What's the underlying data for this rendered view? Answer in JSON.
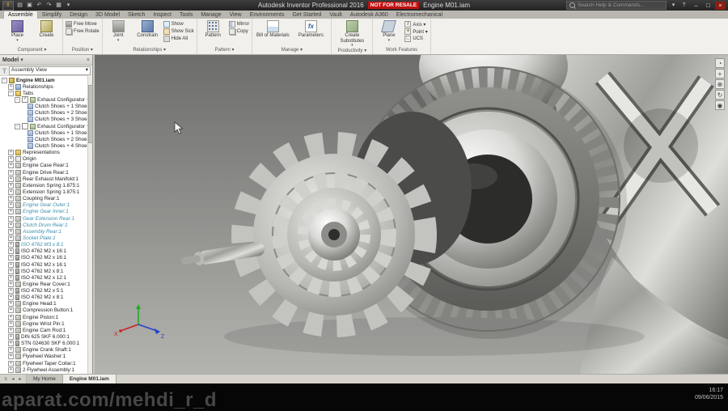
{
  "titlebar": {
    "app_button": "I",
    "app_title": "Autodesk Inventor Professional 2016",
    "license_badge": "NOT FOR RESALE",
    "doc_title": "Engine M01.iam",
    "search_placeholder": "Search Help & Commands...",
    "qat_icons": [
      {
        "name": "open-icon",
        "glyph": "▤"
      },
      {
        "name": "save-icon",
        "glyph": "▣"
      },
      {
        "name": "undo-icon",
        "glyph": "↶"
      },
      {
        "name": "redo-icon",
        "glyph": "↷"
      },
      {
        "name": "print-icon",
        "glyph": "▦"
      },
      {
        "name": "dropdown-icon",
        "glyph": "▾"
      }
    ],
    "right_icons": [
      {
        "name": "sign-in-icon",
        "glyph": "▾"
      },
      {
        "name": "help-icon",
        "glyph": "?"
      }
    ],
    "window": {
      "minimize": "–",
      "maximize": "□",
      "close": "×"
    }
  },
  "ribbon": {
    "tabs": [
      {
        "label": "Assemble",
        "active": true
      },
      {
        "label": "Simplify",
        "active": false
      },
      {
        "label": "Design",
        "active": false
      },
      {
        "label": "3D Model",
        "active": false
      },
      {
        "label": "Sketch",
        "active": false
      },
      {
        "label": "Inspect",
        "active": false
      },
      {
        "label": "Tools",
        "active": false
      },
      {
        "label": "Manage",
        "active": false
      },
      {
        "label": "View",
        "active": false
      },
      {
        "label": "Environments",
        "active": false
      },
      {
        "label": "Get Started",
        "active": false
      },
      {
        "label": "Vault",
        "active": false
      },
      {
        "label": "Autodesk A360",
        "active": false
      },
      {
        "label": "Electromechanical",
        "active": false
      }
    ],
    "panels": [
      {
        "label": "Component",
        "arrow": true,
        "tools": [
          {
            "t": "Place",
            "size": "big",
            "icon": "place",
            "drop": true
          },
          {
            "t": "Create",
            "size": "big",
            "icon": "create"
          }
        ]
      },
      {
        "label": "Position",
        "arrow": true,
        "tools": [
          {
            "t": "Free Move",
            "size": "small",
            "icon": "joint"
          },
          {
            "t": "Free Rotate",
            "size": "small",
            "icon": "copy"
          }
        ]
      },
      {
        "label": "Relationships",
        "arrow": true,
        "tools": [
          {
            "t": "Joint",
            "size": "big",
            "icon": "joint",
            "drop": true
          },
          {
            "t": "Constrain",
            "size": "big",
            "icon": "constrain"
          },
          {
            "t": "Show",
            "size": "small",
            "icon": "show"
          },
          {
            "t": "Show Sick",
            "size": "small",
            "icon": "sick"
          },
          {
            "t": "Hide All",
            "size": "small",
            "icon": "hide"
          }
        ]
      },
      {
        "label": "Pattern",
        "arrow": true,
        "tools": [
          {
            "t": "Pattern",
            "size": "big",
            "icon": "pattern"
          },
          {
            "t": "Mirror",
            "size": "small",
            "icon": "mirror"
          },
          {
            "t": "Copy",
            "size": "small",
            "icon": "copy"
          }
        ]
      },
      {
        "label": "Manage",
        "arrow": true,
        "tools": [
          {
            "t": "Bill of Materials",
            "size": "big2",
            "icon": "bom"
          },
          {
            "t": "Parameters",
            "size": "big2",
            "icon": "fx",
            "glyph": "fx"
          }
        ]
      },
      {
        "label": "Productivity",
        "arrow": true,
        "tools": [
          {
            "t": "Create Substitutes",
            "size": "big2",
            "icon": "subst",
            "drop": true
          }
        ]
      },
      {
        "label": "Work Features",
        "arrow": false,
        "tools": [
          {
            "t": "Plane",
            "size": "big",
            "icon": "plane",
            "drop": true
          },
          {
            "t": "Axis",
            "size": "small",
            "icon": "axis",
            "glyph": "/",
            "drop": true
          },
          {
            "t": "Point",
            "size": "small",
            "icon": "point",
            "glyph": "+",
            "drop": true
          },
          {
            "t": "UCS",
            "size": "small",
            "icon": "ucs",
            "glyph": "∟"
          }
        ]
      }
    ]
  },
  "browser": {
    "header_title": "Model",
    "header_arrow": "▾",
    "header_close": "×",
    "view_selector": "Assembly View",
    "selector_arrow": "▾",
    "tree": [
      {
        "label": "Engine M01.iam",
        "icon": "assembly",
        "level": 0,
        "bold": true,
        "exp": "-"
      },
      {
        "label": "Relationships",
        "icon": "rel",
        "level": 1,
        "exp": "+"
      },
      {
        "label": "Tabs",
        "icon": "folder",
        "level": 1,
        "exp": "-"
      },
      {
        "label": "Exhaust Configurator + Rear",
        "icon": "cfg",
        "level": 2,
        "exp": "-",
        "check": true
      },
      {
        "label": "Clutch Shoes + 1 Shoe",
        "icon": "clutch",
        "level": 3
      },
      {
        "label": "Clutch Shoes + 2 Shoe",
        "icon": "clutch",
        "level": 3
      },
      {
        "label": "Clutch Shoes + 3 Shoe",
        "icon": "clutch",
        "level": 3
      },
      {
        "label": "Exhaust Configurator + Side",
        "icon": "cfg",
        "level": 2,
        "exp": "-",
        "check": false
      },
      {
        "label": "Clutch Shoes + 1 Shoe",
        "icon": "clutch",
        "level": 3
      },
      {
        "label": "Clutch Shoes + 2 Shoe",
        "icon": "clutch",
        "level": 3
      },
      {
        "label": "Clutch Shoes + 4 Shoe",
        "icon": "clutch",
        "level": 3
      },
      {
        "label": "Representations",
        "icon": "folder",
        "level": 1,
        "exp": "+"
      },
      {
        "label": "Origin",
        "icon": "origin",
        "level": 1,
        "exp": "+"
      },
      {
        "label": "Engine Case Rear:1",
        "icon": "part",
        "level": 1,
        "exp": "+"
      },
      {
        "label": "Engine Drive Rear:1",
        "icon": "part",
        "level": 1,
        "exp": "+"
      },
      {
        "label": "Rear Exhaust Manifold:1",
        "icon": "part",
        "level": 1,
        "exp": "+"
      },
      {
        "label": "Extension Spring 1.875:1",
        "icon": "part",
        "level": 1,
        "exp": "+"
      },
      {
        "label": "Extension Spring 1.875:1",
        "icon": "part",
        "level": 1,
        "exp": "+"
      },
      {
        "label": "Coupling Rear:1",
        "icon": "part",
        "level": 1,
        "exp": "+"
      },
      {
        "label": "Engine Gear Outer:1",
        "icon": "part",
        "level": 1,
        "exp": "+",
        "hl": true
      },
      {
        "label": "Engine Gear Inner:1",
        "icon": "part",
        "level": 1,
        "exp": "+",
        "hl": true
      },
      {
        "label": "Gear Extension Rear:1",
        "icon": "part",
        "level": 1,
        "exp": "+",
        "hl": true
      },
      {
        "label": "Clutch Drum Rear:1",
        "icon": "part",
        "level": 1,
        "exp": "+",
        "hl": true
      },
      {
        "label": "Assembly Rear:1",
        "icon": "part",
        "level": 1,
        "exp": "+",
        "hl": true
      },
      {
        "label": "Socket Plate:1",
        "icon": "part",
        "level": 1,
        "exp": "+",
        "hl": true
      },
      {
        "label": "ISO 4762 M3 x 8:1",
        "icon": "bolt",
        "level": 1,
        "exp": "+",
        "hl": true
      },
      {
        "label": "ISO 4762 M2 x 16:1",
        "icon": "bolt",
        "level": 1,
        "exp": "+"
      },
      {
        "label": "ISO 4762 M2 x 16:1",
        "icon": "bolt",
        "level": 1,
        "exp": "+"
      },
      {
        "label": "ISO 4762 M2 x 16:1",
        "icon": "bolt",
        "level": 1,
        "exp": "+"
      },
      {
        "label": "ISO 4762 M2 x 8:1",
        "icon": "bolt",
        "level": 1,
        "exp": "+"
      },
      {
        "label": "ISO 4762 M2 x 12:1",
        "icon": "bolt",
        "level": 1,
        "exp": "+"
      },
      {
        "label": "Engine Rear Cover:1",
        "icon": "part",
        "level": 1,
        "exp": "+"
      },
      {
        "label": "ISO 4762 M2 x 5:1",
        "icon": "bolt",
        "level": 1,
        "exp": "+"
      },
      {
        "label": "ISO 4762 M2 x 8:1",
        "icon": "bolt",
        "level": 1,
        "exp": "+"
      },
      {
        "label": "Engine Head:1",
        "icon": "part",
        "level": 1,
        "exp": "+"
      },
      {
        "label": "Compression Button:1",
        "icon": "part",
        "level": 1,
        "exp": "+"
      },
      {
        "label": "Engine Piston:1",
        "icon": "part",
        "level": 1,
        "exp": "+"
      },
      {
        "label": "Engine Wrist Pin:1",
        "icon": "part",
        "level": 1,
        "exp": "+"
      },
      {
        "label": "Engine Cam Rod:1",
        "icon": "part",
        "level": 1,
        "exp": "+"
      },
      {
        "label": "DIN 625 SKF 6.000:1",
        "icon": "bolt",
        "level": 1,
        "exp": "+"
      },
      {
        "label": "STN 024630 SKF 6.000:1",
        "icon": "bolt",
        "level": 1,
        "exp": "+"
      },
      {
        "label": "Engine Crank Shaft:1",
        "icon": "part",
        "level": 1,
        "exp": "+"
      },
      {
        "label": "Flywheel Washer:1",
        "icon": "part",
        "level": 1,
        "exp": "+"
      },
      {
        "label": "Flywheel Taper Collar:1",
        "icon": "part",
        "level": 1,
        "exp": "+"
      },
      {
        "label": "2 Flywheel Assembly:1",
        "icon": "part",
        "level": 1,
        "exp": "+"
      }
    ]
  },
  "viewport": {
    "axis": {
      "x": "X",
      "z": "Z"
    },
    "nav_icons": [
      {
        "name": "navigation-wheel-icon",
        "glyph": "◔"
      },
      {
        "name": "pan-icon",
        "glyph": "+"
      },
      {
        "name": "zoom-icon",
        "glyph": "⊕"
      },
      {
        "name": "orbit-icon",
        "glyph": "↻"
      },
      {
        "name": "look-at-icon",
        "glyph": "◉"
      }
    ]
  },
  "docbar": {
    "nav_icons": [
      "≡",
      "◂",
      "▸"
    ],
    "tabs": [
      {
        "label": "My Home",
        "active": false
      },
      {
        "label": "Engine M01.iam",
        "active": true
      }
    ]
  },
  "footer": {
    "watermark": "aparat.com/mehdi_r_d",
    "time": "16:17",
    "date": "09/06/2015"
  },
  "colors": {
    "badge_red": "#c01010",
    "highlight_teal": "#3a8fae",
    "viewport_top": "#6d6d6b",
    "viewport_bottom": "#b3b3af"
  }
}
